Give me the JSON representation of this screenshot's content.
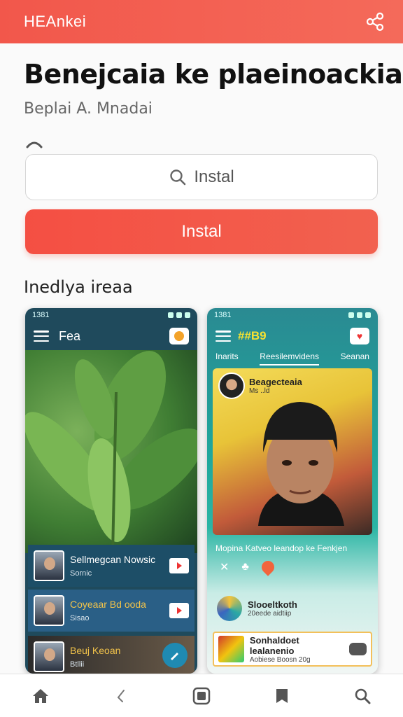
{
  "topbar": {
    "brand": "HEAnkei",
    "icons": [
      "share-icon"
    ]
  },
  "hero": {
    "title": "Benejcaia ke plaeinoackia",
    "subtitle": "Beplai A. Mnadai"
  },
  "search": {
    "placeholder": "Instal"
  },
  "install_button": {
    "label": "Instal"
  },
  "section": {
    "label": "Inedlya ireaa"
  },
  "phone1": {
    "time": "1381",
    "header_title": "Fea",
    "cards": [
      {
        "title": "Sellmegcan Nowsic",
        "sub": "Sornic"
      },
      {
        "title": "Coyeaar Bd ooda",
        "sub": "Sisao"
      },
      {
        "title": "Beuj Keoan",
        "sub": "Btllii"
      }
    ]
  },
  "phone2": {
    "time": "1381",
    "logo": "##B9",
    "tabs": [
      "Inarits",
      "Reesilemvidens",
      "Seanan"
    ],
    "channel_name": "Beagecteaia",
    "channel_sub": "Ms ..ld",
    "caption": "Mopina Katveo leandop ke Fenkjen",
    "row1": {
      "title": "Slooeltkoth",
      "sub": "20eede aidtiip"
    },
    "row2": {
      "title": "Sonhaldoet lealanenio",
      "sub": "Aobiese Boosn 20g"
    }
  },
  "bottom_nav": [
    "home-icon",
    "back-icon",
    "apps-icon",
    "bookmark-icon",
    "search-icon"
  ],
  "colors": {
    "accent": "#f2574b",
    "phone1_bg": "#1f4a5c",
    "phone2_bg": "#1fa79c"
  }
}
